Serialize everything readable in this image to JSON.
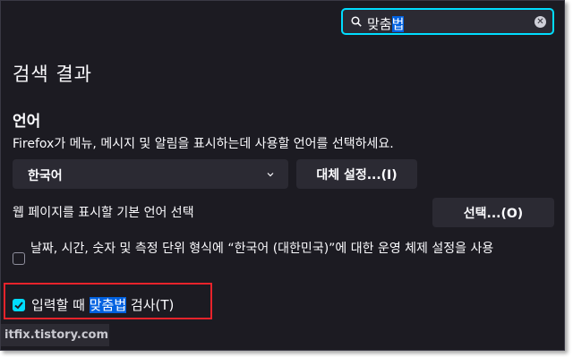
{
  "search": {
    "value_prefix": "맞춤",
    "value_highlight": "법",
    "clear_icon": "clear-icon"
  },
  "results_title": "검색 결과",
  "language": {
    "title": "언어",
    "description": "Firefox가 메뉴, 메시지 및 알림을 표시하는데 사용할 언어를 선택하세요.",
    "selected_language": "한국어",
    "alternatives_button": "대체 설정...(I)",
    "web_pages_label": "웹 페이지를 표시할 기본 언어 선택",
    "choose_button": "선택...(O)",
    "regional_checkbox_label": "날짜, 시간, 숫자 및 측정 단위 형식에 “한국어 (대한민국)”에 대한 운영 체제 설정을 사용",
    "regional_checked": false,
    "spellcheck_prefix": "입력할 때 ",
    "spellcheck_highlight": "맞춤법",
    "spellcheck_suffix": " 검사(T)",
    "spellcheck_checked": true
  },
  "watermark": "itfix.tistory.com",
  "colors": {
    "background": "#1c1b22",
    "accent": "#00ddff",
    "highlight": "#0061e0",
    "annotation": "#e8232b"
  }
}
